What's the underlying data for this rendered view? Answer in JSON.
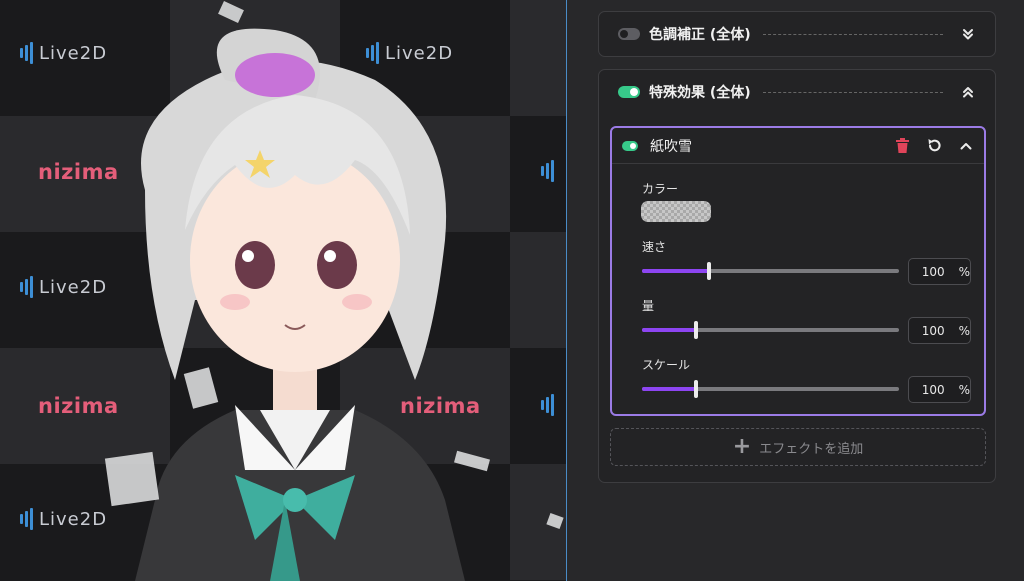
{
  "preview": {
    "live2d_text": "Live2D",
    "nizima_text": "nizima"
  },
  "panel": {
    "color_correction": {
      "label": "色調補正 (全体)",
      "enabled": false,
      "expanded": false
    },
    "special_effects": {
      "label": "特殊効果 (全体)",
      "enabled": true,
      "expanded": true,
      "effect": {
        "name": "紙吹雪",
        "enabled": true,
        "color_label": "カラー",
        "sliders": [
          {
            "label": "速さ",
            "value": "100",
            "unit": "%",
            "fraction": 0.26
          },
          {
            "label": "量",
            "value": "100",
            "unit": "%",
            "fraction": 0.21
          },
          {
            "label": "スケール",
            "value": "100",
            "unit": "%",
            "fraction": 0.21
          }
        ]
      },
      "add_effect_label": "エフェクトを追加"
    }
  },
  "colors": {
    "accent_purple": "#9b7be6",
    "toggle_on": "#37c98a",
    "delete_red": "#e0445a",
    "nizima_pink": "#e45e7a",
    "live2d_blue": "#3d8fd6"
  }
}
